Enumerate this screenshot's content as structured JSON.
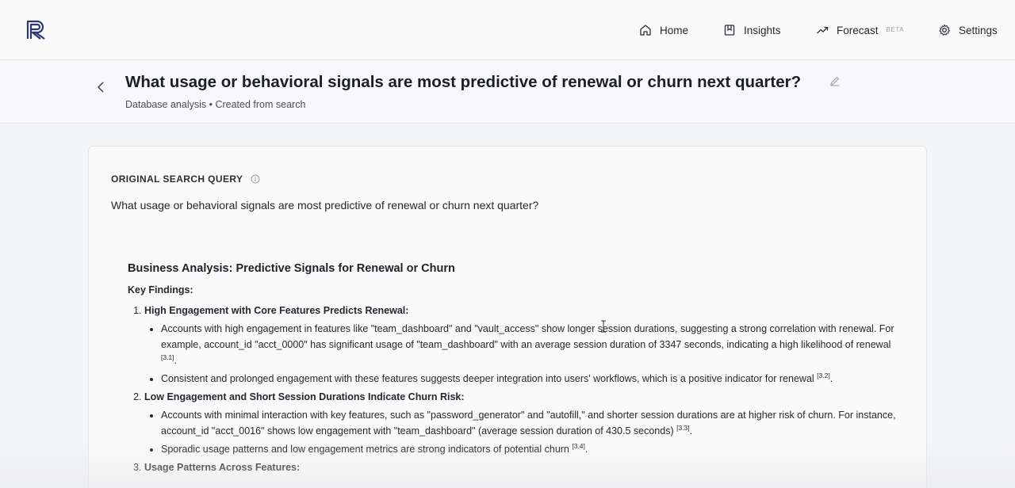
{
  "nav": {
    "logo_icon": "r-logo-icon",
    "items": [
      {
        "label": "Home",
        "icon": "home-icon"
      },
      {
        "label": "Insights",
        "icon": "bookmark-icon"
      },
      {
        "label": "Forecast",
        "icon": "trending-up-icon",
        "badge": "BETA"
      },
      {
        "label": "Settings",
        "icon": "gear-icon"
      }
    ]
  },
  "header": {
    "title": "What usage or behavioral signals are most predictive of renewal or churn next quarter?",
    "subtitle": "Database analysis • Created from search"
  },
  "card": {
    "section_label": "ORIGINAL SEARCH QUERY",
    "query": "What usage or behavioral signals are most predictive of renewal or churn next quarter?",
    "analysis_title": "Business Analysis: Predictive Signals for Renewal or Churn",
    "key_findings_label": "Key Findings:",
    "findings": [
      {
        "title": "High Engagement with Core Features Predicts Renewal:",
        "points": [
          {
            "text": "Accounts with high engagement in features like \"team_dashboard\" and \"vault_access\" show longer session durations, suggesting a strong correlation with renewal. For example, account_id \"acct_0000\" has significant usage of \"team_dashboard\" with an average session duration of 3347 seconds, indicating a high likelihood of renewal ",
            "cite": "[3.1]",
            "tail": "."
          },
          {
            "text": "Consistent and prolonged engagement with these features suggests deeper integration into users' workflows, which is a positive indicator for renewal ",
            "cite": "[3.2]",
            "tail": "."
          }
        ]
      },
      {
        "title": "Low Engagement and Short Session Durations Indicate Churn Risk:",
        "points": [
          {
            "text": "Accounts with minimal interaction with key features, such as \"password_generator\" and \"autofill,\" and shorter session durations are at higher risk of churn. For instance, account_id \"acct_0016\" shows low engagement with \"team_dashboard\" (average session duration of 430.5 seconds) ",
            "cite": "[3.3]",
            "tail": "."
          },
          {
            "text": "Sporadic usage patterns and low engagement metrics are strong indicators of potential churn ",
            "cite": "[3.4]",
            "tail": "."
          }
        ]
      },
      {
        "title": "Usage Patterns Across Features:",
        "points": []
      }
    ]
  },
  "colors": {
    "nav_bg": "#fafafa",
    "page_bg": "#f4f5f7",
    "logo": "#2b3a6b",
    "text": "#1f2328"
  }
}
